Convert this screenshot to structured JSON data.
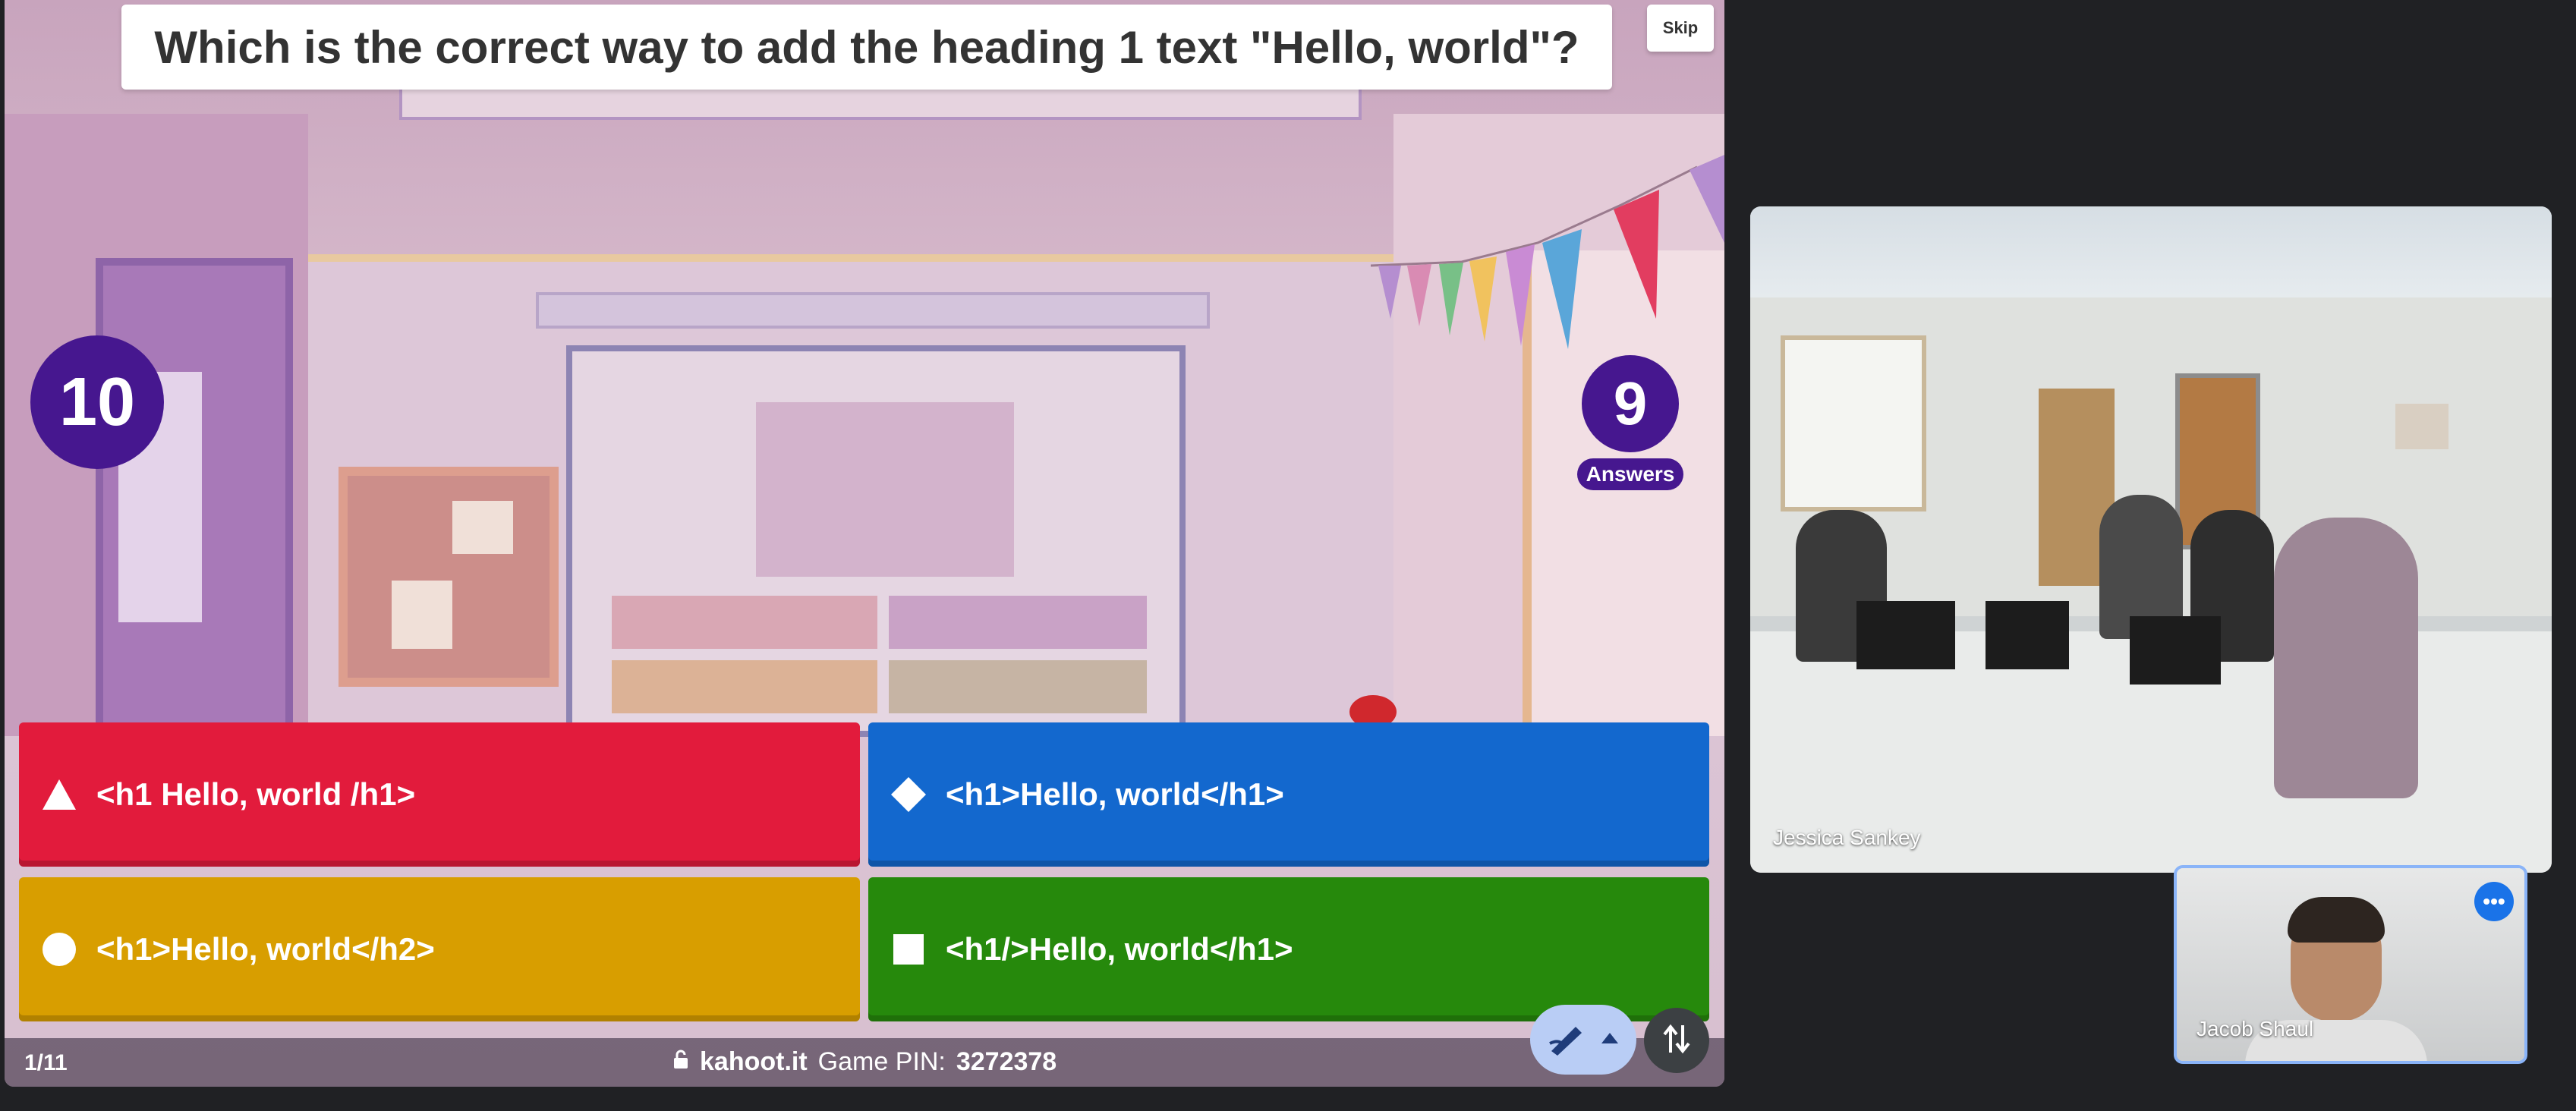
{
  "question": {
    "text": "Which is the correct way to add the heading 1 text \"Hello, world\"?",
    "skip_label": "Skip"
  },
  "timer": "10",
  "answers_count": {
    "value": "9",
    "label": "Answers"
  },
  "answers": [
    {
      "shape": "triangle-icon",
      "text": "<h1 Hello, world /h1>",
      "color": "#e21b3c"
    },
    {
      "shape": "diamond-icon",
      "text": "<h1>Hello, world</h1>",
      "color": "#1368ce"
    },
    {
      "shape": "circle-icon",
      "text": "<h1>Hello, world</h2>",
      "color": "#d89e00"
    },
    {
      "shape": "square-icon",
      "text": "<h1/>Hello, world</h1>",
      "color": "#26890c"
    }
  ],
  "footer": {
    "progress": "1/11",
    "site": "kahoot.it",
    "pin_label": "Game PIN:",
    "pin_value": "3272378"
  },
  "participants": {
    "main_name": "Jessica Sankey",
    "self_name": "Jacob Shaul"
  },
  "colors": {
    "kahoot_purple": "#46178f",
    "meet_bg": "#202124",
    "self_border": "#8ab4f8"
  }
}
